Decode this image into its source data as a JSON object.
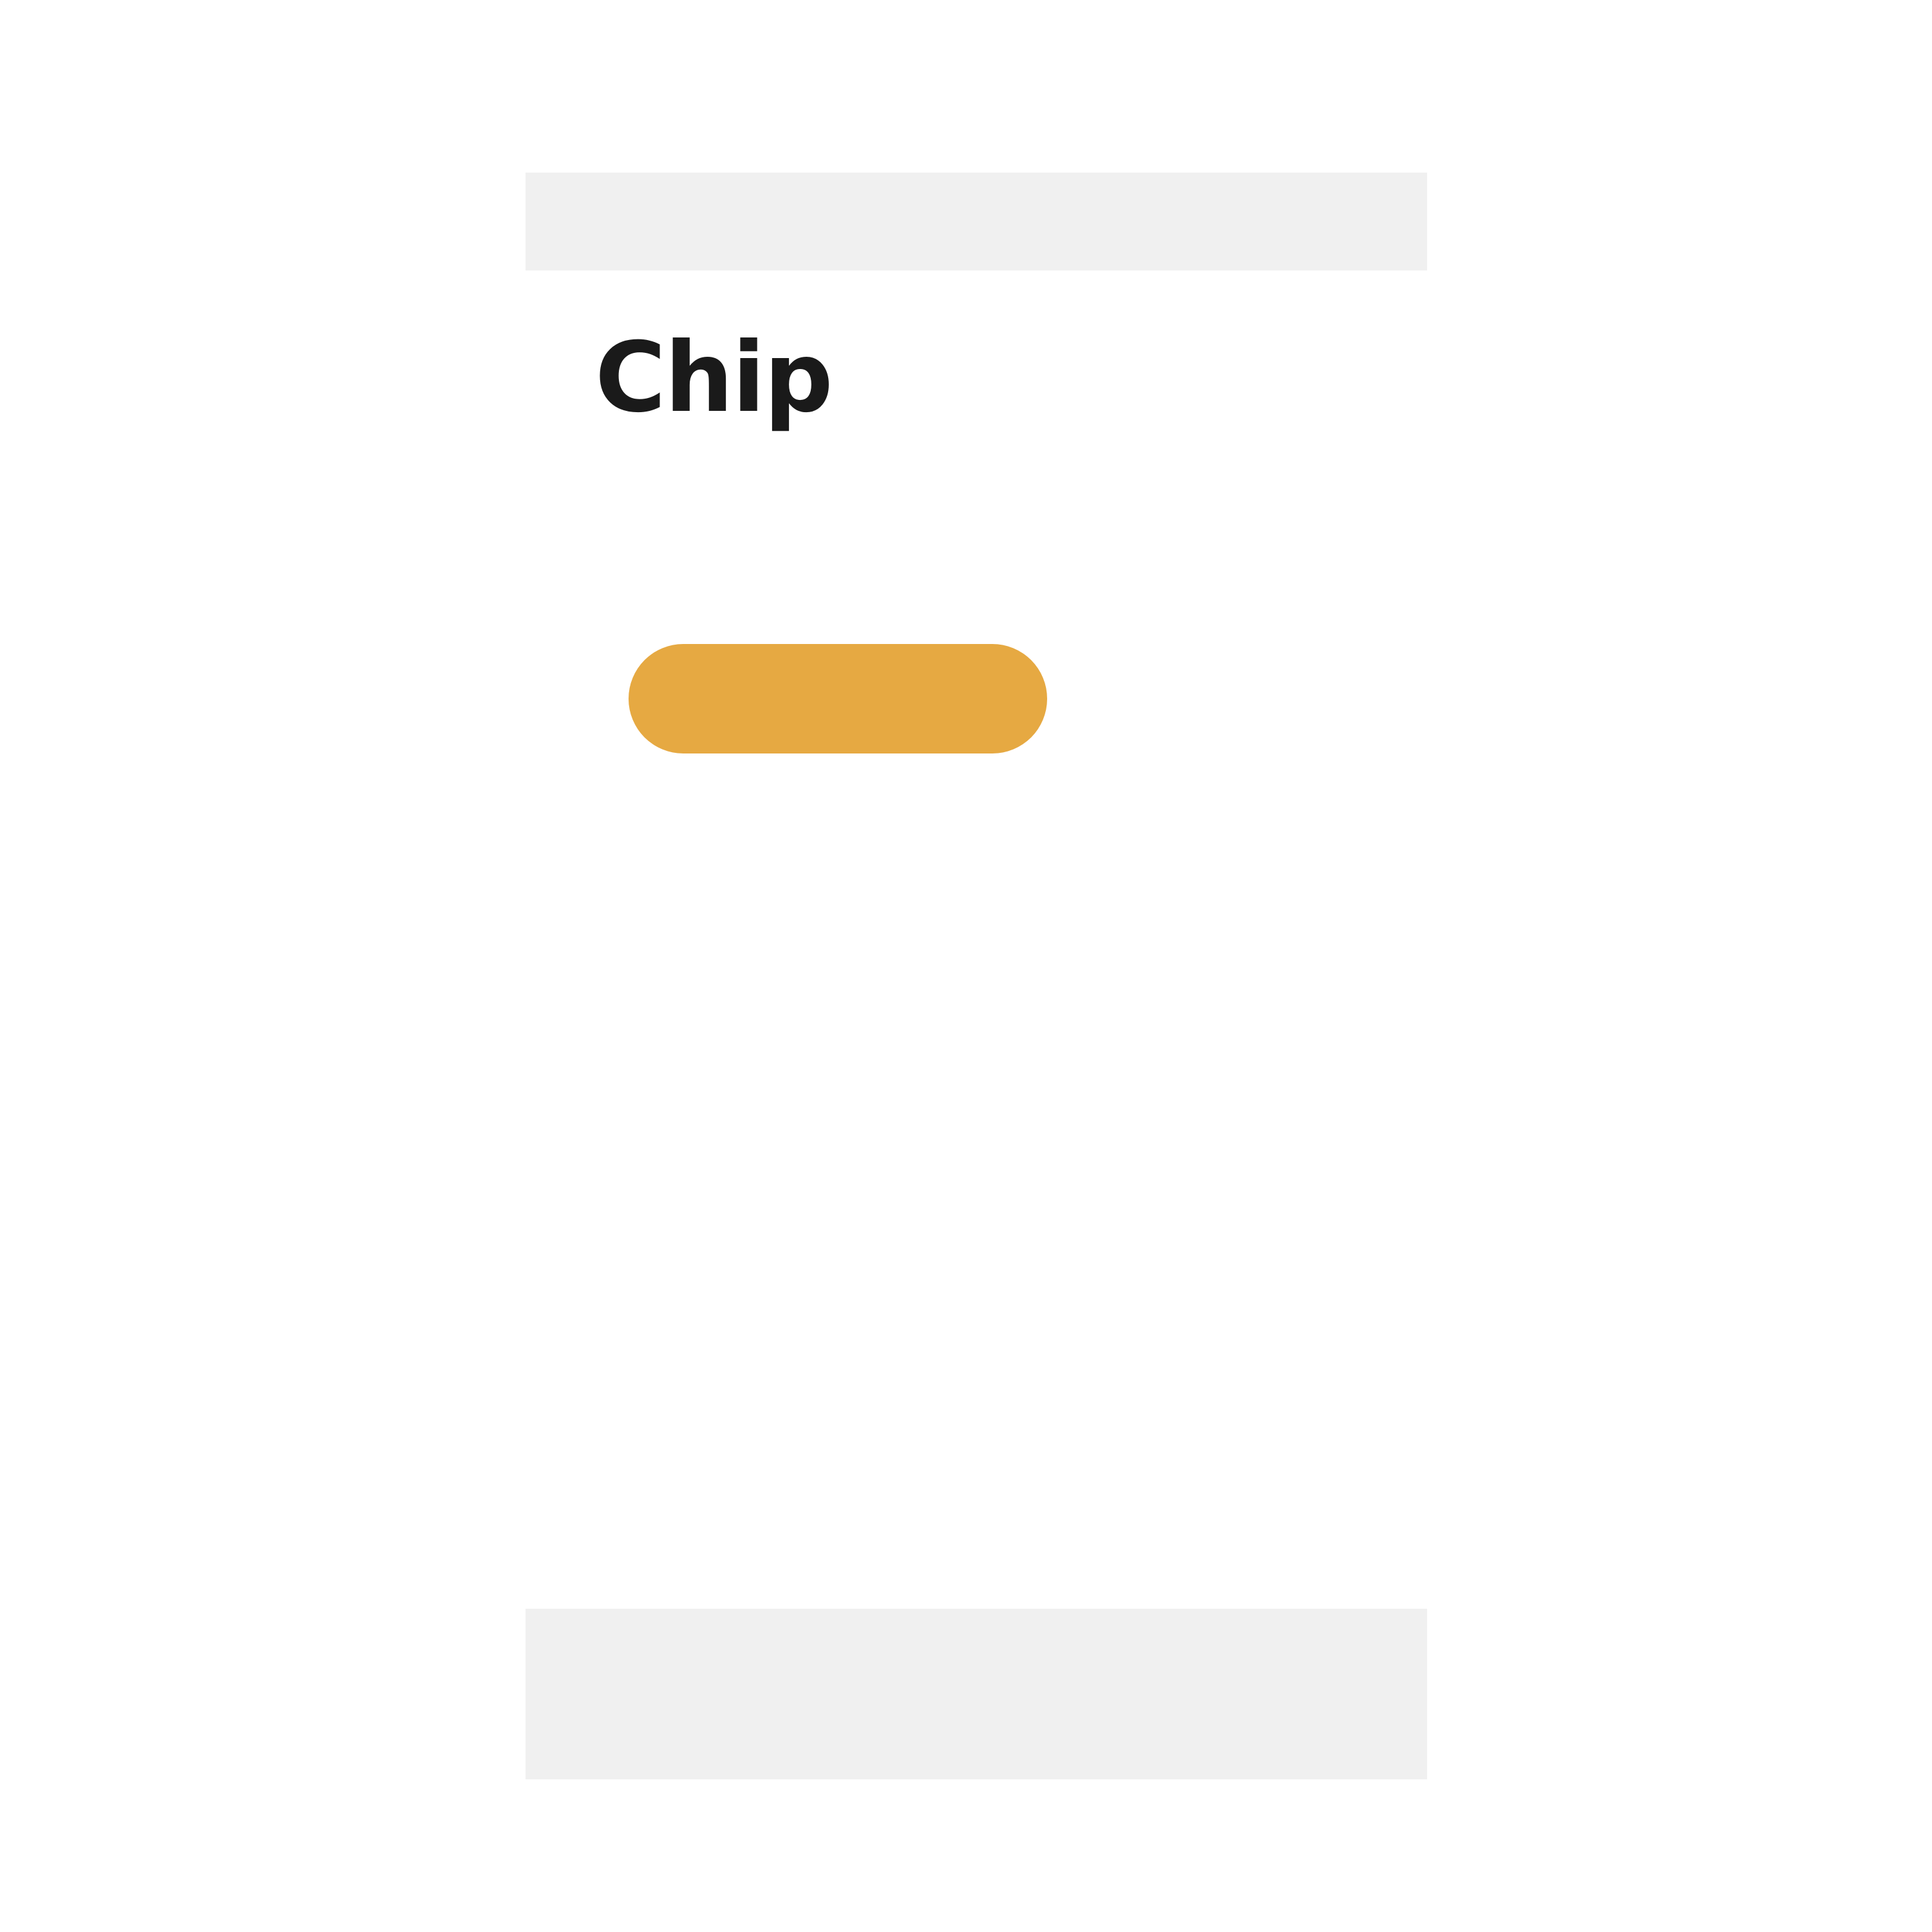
{
  "page": {
    "title": "Chip"
  },
  "chip": {
    "label": "",
    "color": "#e6a942"
  },
  "colors": {
    "bar_background": "#f0f0f0",
    "text": "#1a1a1a",
    "background": "#ffffff"
  }
}
